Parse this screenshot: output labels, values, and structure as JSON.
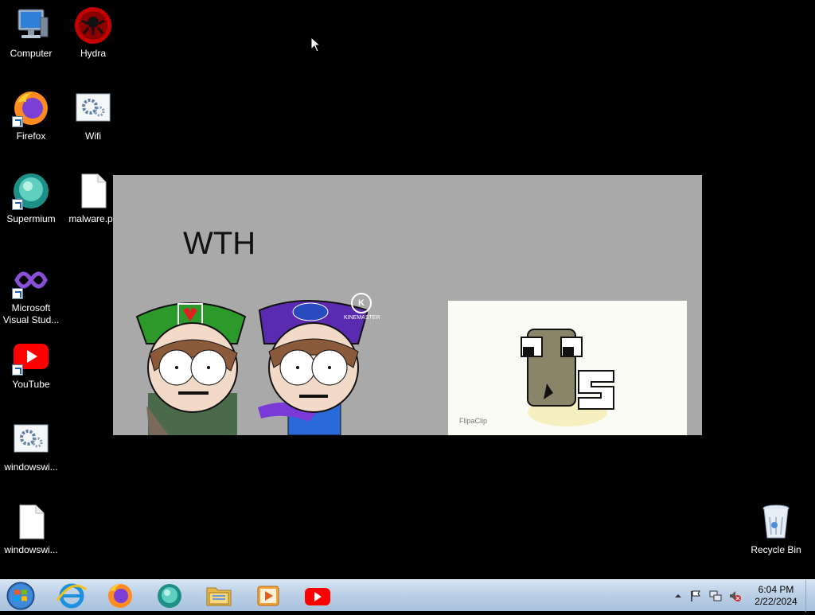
{
  "desktop": {
    "icons": [
      {
        "label": "Computer"
      },
      {
        "label": "Hydra"
      },
      {
        "label": "Firefox"
      },
      {
        "label": "Wifi"
      },
      {
        "label": "Supermium"
      },
      {
        "label": "malware.py"
      },
      {
        "label": "Microsoft Visual Stud..."
      },
      {
        "label": "YouTube"
      },
      {
        "label": "windowswi..."
      },
      {
        "label": "windowswi..."
      },
      {
        "label": "Recycle Bin"
      }
    ]
  },
  "video": {
    "title": "WTH",
    "watermark": "KINEMASTER",
    "watermark_logo": "K",
    "inset_credit": "FlipaClip"
  },
  "taskbar": {
    "pinned": [
      {
        "icon": "internet-explorer-icon"
      },
      {
        "icon": "firefox-icon"
      },
      {
        "icon": "supermium-icon"
      },
      {
        "icon": "file-explorer-icon"
      },
      {
        "icon": "media-player-icon"
      },
      {
        "icon": "youtube-icon"
      }
    ],
    "clock": {
      "time": "6:04 PM",
      "date": "2/22/2024"
    }
  },
  "colors": {
    "desktop_bg": "#000000",
    "taskbar_bg": "#bcd0e7",
    "video_bg": "#a9a9a9"
  }
}
